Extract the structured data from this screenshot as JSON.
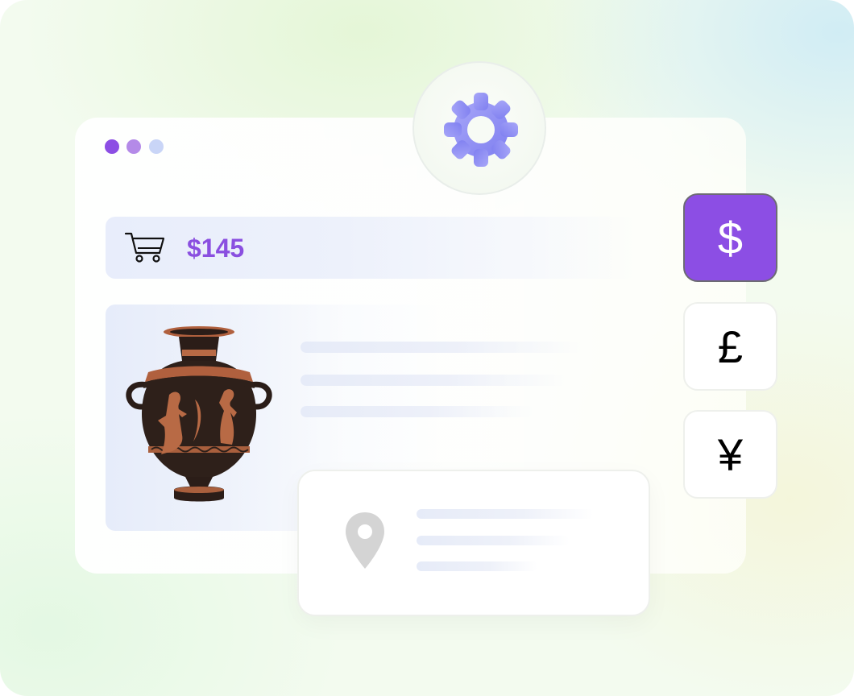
{
  "colors": {
    "accent": "#8c4ee4",
    "dot_1": "#8c4ee4",
    "dot_2": "#b48ae8",
    "dot_3": "#c9d5f7",
    "gear": "#8f8ef2",
    "pin": "#d4d4d4"
  },
  "gear_badge": {
    "icon": "gear-icon"
  },
  "cart": {
    "icon": "shopping-cart-icon",
    "price": "$145"
  },
  "product": {
    "image": "greek-vase-image"
  },
  "location_card": {
    "icon": "map-pin-icon"
  },
  "currencies": [
    {
      "symbol": "$",
      "selected": true
    },
    {
      "symbol": "£",
      "selected": false
    },
    {
      "symbol": "¥",
      "selected": false
    }
  ]
}
